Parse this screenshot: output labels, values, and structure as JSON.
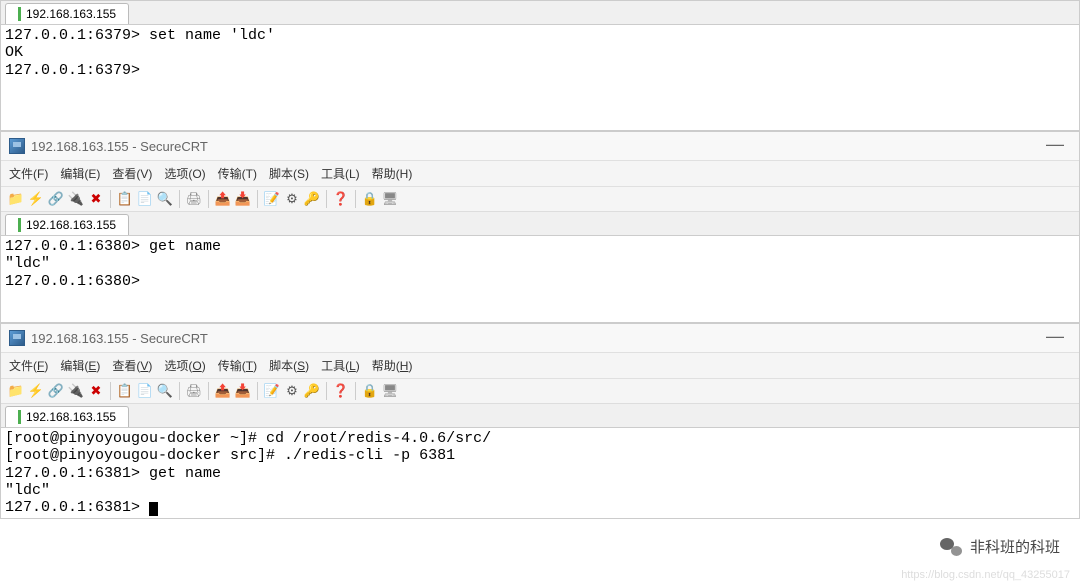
{
  "tab_label": "192.168.163.155",
  "window_title": "192.168.163.155 - SecureCRT",
  "menus": {
    "file": "文件(F)",
    "edit": "编辑(E)",
    "view": "查看(V)",
    "options": "选项(O)",
    "transfer": "传输(T)",
    "script": "脚本(S)",
    "tools": "工具(L)",
    "help": "帮助(H)"
  },
  "terminals": {
    "t1_line1": "127.0.0.1:6379> set name 'ldc'",
    "t1_line2": "OK",
    "t1_line3": "127.0.0.1:6379>",
    "t2_line1": "127.0.0.1:6380> get name",
    "t2_line2": "\"ldc\"",
    "t2_line3": "127.0.0.1:6380>",
    "t3_line1": "[root@pinyoyougou-docker ~]# cd /root/redis-4.0.6/src/",
    "t3_line2": "[root@pinyoyougou-docker src]# ./redis-cli -p 6381",
    "t3_line3": "127.0.0.1:6381> get name",
    "t3_line4": "\"ldc\"",
    "t3_line5": "127.0.0.1:6381> "
  },
  "watermark_text": "非科班的科班",
  "csdn_watermark": "https://blog.csdn.net/qq_43255017"
}
